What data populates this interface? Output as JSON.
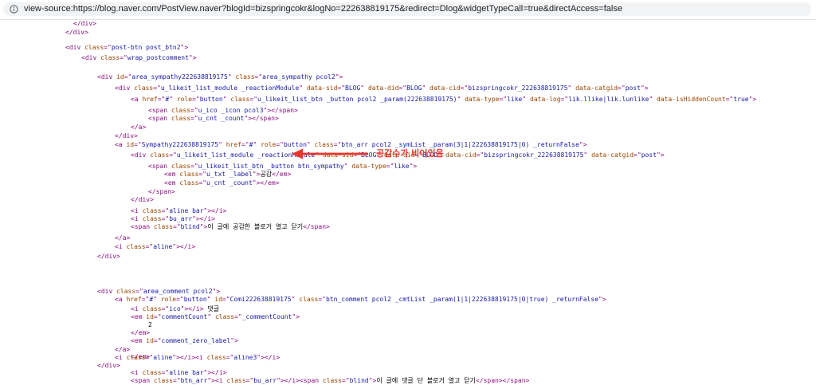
{
  "address_bar": {
    "url": "view-source:https://blog.naver.com/PostView.naver?blogId=bizspringcokr&logNo=222638819175&redirect=Dlog&widgetTypeCall=true&directAccess=false",
    "icon": "info-icon"
  },
  "annotation": {
    "text": "공감수가 비어있음",
    "color": "#e8382c",
    "icon": "arrow-left-icon"
  },
  "source_lines": [
    [
      {
        "t": "tag",
        "v": "</div>"
      }
    ],
    [
      {
        "t": "tag",
        "v": "</div>"
      }
    ],
    [],
    [
      {
        "t": "tag",
        "v": "<div "
      },
      {
        "t": "attr",
        "v": "class"
      },
      {
        "t": "tag",
        "v": "=\""
      },
      {
        "t": "val",
        "v": "post-btn post_btn2"
      },
      {
        "t": "tag",
        "v": "\">"
      }
    ],
    [
      {
        "t": "tag",
        "v": "<div "
      },
      {
        "t": "attr",
        "v": "class"
      },
      {
        "t": "tag",
        "v": "=\""
      },
      {
        "t": "val",
        "v": "wrap_postcomment"
      },
      {
        "t": "tag",
        "v": "\">"
      }
    ],
    [],
    [
      {
        "t": "tag",
        "v": "<div "
      },
      {
        "t": "attr",
        "v": "id"
      },
      {
        "t": "tag",
        "v": "=\""
      },
      {
        "t": "val",
        "v": "area_sympathy222638819175"
      },
      {
        "t": "tag",
        "v": "\" "
      },
      {
        "t": "attr",
        "v": "class"
      },
      {
        "t": "tag",
        "v": "=\""
      },
      {
        "t": "val",
        "v": "area_sympathy pcol2"
      },
      {
        "t": "tag",
        "v": "\">"
      }
    ],
    [
      {
        "t": "tag",
        "v": "<div "
      },
      {
        "t": "attr",
        "v": "class"
      },
      {
        "t": "tag",
        "v": "=\""
      },
      {
        "t": "val",
        "v": "u_likeit_list_module _reactionModule"
      },
      {
        "t": "tag",
        "v": "\" "
      },
      {
        "t": "attr",
        "v": "data-sid"
      },
      {
        "t": "tag",
        "v": "=\""
      },
      {
        "t": "val",
        "v": "BLOG"
      },
      {
        "t": "tag",
        "v": "\" "
      },
      {
        "t": "attr",
        "v": "data-did"
      },
      {
        "t": "tag",
        "v": "=\""
      },
      {
        "t": "val",
        "v": "BLOG"
      },
      {
        "t": "tag",
        "v": "\" "
      },
      {
        "t": "attr",
        "v": "data-cid"
      },
      {
        "t": "tag",
        "v": "=\""
      },
      {
        "t": "val",
        "v": "bizspringcokr_222638819175"
      },
      {
        "t": "tag",
        "v": "\" "
      },
      {
        "t": "attr",
        "v": "data-catgid"
      },
      {
        "t": "tag",
        "v": "=\""
      },
      {
        "t": "val",
        "v": "post"
      },
      {
        "t": "tag",
        "v": "\">"
      }
    ],
    [
      {
        "t": "tag",
        "v": "<a "
      },
      {
        "t": "attr",
        "v": "href"
      },
      {
        "t": "tag",
        "v": "=\""
      },
      {
        "t": "val",
        "v": "#"
      },
      {
        "t": "tag",
        "v": "\" "
      },
      {
        "t": "attr",
        "v": "role"
      },
      {
        "t": "tag",
        "v": "=\""
      },
      {
        "t": "val",
        "v": "button"
      },
      {
        "t": "tag",
        "v": "\" "
      },
      {
        "t": "attr",
        "v": "class"
      },
      {
        "t": "tag",
        "v": "=\""
      },
      {
        "t": "val",
        "v": "u_likeit_list_btn _button pcol2 _param(222638819175)"
      },
      {
        "t": "tag",
        "v": "\" "
      },
      {
        "t": "attr",
        "v": "data-type"
      },
      {
        "t": "tag",
        "v": "=\""
      },
      {
        "t": "val",
        "v": "like"
      },
      {
        "t": "tag",
        "v": "\" "
      },
      {
        "t": "attr",
        "v": "data-log"
      },
      {
        "t": "tag",
        "v": "=\""
      },
      {
        "t": "val",
        "v": "lik.llike|lik.lunlike"
      },
      {
        "t": "tag",
        "v": "\" "
      },
      {
        "t": "attr",
        "v": "data-isHiddenCount"
      },
      {
        "t": "tag",
        "v": "=\""
      },
      {
        "t": "val",
        "v": "true"
      },
      {
        "t": "tag",
        "v": "\">"
      }
    ],
    [
      {
        "t": "tag",
        "v": "<span "
      },
      {
        "t": "attr",
        "v": "class"
      },
      {
        "t": "tag",
        "v": "=\""
      },
      {
        "t": "val",
        "v": "u_ico _icon pcol3"
      },
      {
        "t": "tag",
        "v": "\"></span>"
      }
    ],
    [
      {
        "t": "tag",
        "v": "<span "
      },
      {
        "t": "attr",
        "v": "class"
      },
      {
        "t": "tag",
        "v": "=\""
      },
      {
        "t": "val",
        "v": "u_cnt _count"
      },
      {
        "t": "tag",
        "v": "\"></span>"
      }
    ],
    [
      {
        "t": "tag",
        "v": "</a>"
      }
    ],
    [
      {
        "t": "tag",
        "v": "</div>"
      }
    ],
    [
      {
        "t": "tag",
        "v": "<a "
      },
      {
        "t": "attr",
        "v": "id"
      },
      {
        "t": "tag",
        "v": "=\""
      },
      {
        "t": "val",
        "v": "Sympathy222638819175"
      },
      {
        "t": "tag",
        "v": "\" "
      },
      {
        "t": "attr",
        "v": "href"
      },
      {
        "t": "tag",
        "v": "=\""
      },
      {
        "t": "val",
        "v": "#"
      },
      {
        "t": "tag",
        "v": "\" "
      },
      {
        "t": "attr",
        "v": "role"
      },
      {
        "t": "tag",
        "v": "=\""
      },
      {
        "t": "val",
        "v": "button"
      },
      {
        "t": "tag",
        "v": "\" "
      },
      {
        "t": "attr",
        "v": "class"
      },
      {
        "t": "tag",
        "v": "=\""
      },
      {
        "t": "val",
        "v": "btn_arr pcol2 _symList _param(3|1|222638819175|0) _returnFalse"
      },
      {
        "t": "tag",
        "v": "\">"
      }
    ],
    [
      {
        "t": "tag",
        "v": "<div "
      },
      {
        "t": "attr",
        "v": "class"
      },
      {
        "t": "tag",
        "v": "=\""
      },
      {
        "t": "val",
        "v": "u_likeit_list_module _reactionModule"
      },
      {
        "t": "tag",
        "v": "\" "
      },
      {
        "t": "attr",
        "v": "data-sid"
      },
      {
        "t": "tag",
        "v": "=\""
      },
      {
        "t": "val",
        "v": "BLOG"
      },
      {
        "t": "tag",
        "v": "\" "
      },
      {
        "t": "attr",
        "v": "data-did"
      },
      {
        "t": "tag",
        "v": "=\""
      },
      {
        "t": "val",
        "v": "BLOG"
      },
      {
        "t": "tag",
        "v": "\" "
      },
      {
        "t": "attr",
        "v": "data-cid"
      },
      {
        "t": "tag",
        "v": "=\""
      },
      {
        "t": "val",
        "v": "bizspringcokr_222638819175"
      },
      {
        "t": "tag",
        "v": "\" "
      },
      {
        "t": "attr",
        "v": "data-catgid"
      },
      {
        "t": "tag",
        "v": "=\""
      },
      {
        "t": "val",
        "v": "post"
      },
      {
        "t": "tag",
        "v": "\">"
      }
    ],
    [
      {
        "t": "tag",
        "v": "<span "
      },
      {
        "t": "attr",
        "v": "class"
      },
      {
        "t": "tag",
        "v": "=\""
      },
      {
        "t": "val",
        "v": "u_likeit_list_btn _button btn_sympathy"
      },
      {
        "t": "tag",
        "v": "\" "
      },
      {
        "t": "attr",
        "v": "data-type"
      },
      {
        "t": "tag",
        "v": "=\""
      },
      {
        "t": "val",
        "v": "like"
      },
      {
        "t": "tag",
        "v": "\">"
      }
    ],
    [
      {
        "t": "tag",
        "v": "<em "
      },
      {
        "t": "attr",
        "v": "class"
      },
      {
        "t": "tag",
        "v": "=\""
      },
      {
        "t": "val",
        "v": "u_txt _label"
      },
      {
        "t": "tag",
        "v": "\">"
      },
      {
        "t": "text",
        "v": "공감"
      },
      {
        "t": "tag",
        "v": "</em>"
      }
    ],
    [
      {
        "t": "tag",
        "v": "<em "
      },
      {
        "t": "attr",
        "v": "class"
      },
      {
        "t": "tag",
        "v": "=\""
      },
      {
        "t": "val",
        "v": "u_cnt _count"
      },
      {
        "t": "tag",
        "v": "\"></em>"
      }
    ],
    [
      {
        "t": "tag",
        "v": "</span>"
      }
    ],
    [
      {
        "t": "tag",
        "v": "</div>"
      }
    ],
    [
      {
        "t": "tag",
        "v": "<i "
      },
      {
        "t": "attr",
        "v": "class"
      },
      {
        "t": "tag",
        "v": "=\""
      },
      {
        "t": "val",
        "v": "aline bar"
      },
      {
        "t": "tag",
        "v": "\"></i>"
      }
    ],
    [
      {
        "t": "tag",
        "v": "<i "
      },
      {
        "t": "attr",
        "v": "class"
      },
      {
        "t": "tag",
        "v": "=\""
      },
      {
        "t": "val",
        "v": "bu_arr"
      },
      {
        "t": "tag",
        "v": "\"></i>"
      }
    ],
    [
      {
        "t": "tag",
        "v": "<span "
      },
      {
        "t": "attr",
        "v": "class"
      },
      {
        "t": "tag",
        "v": "=\""
      },
      {
        "t": "val",
        "v": "blind"
      },
      {
        "t": "tag",
        "v": "\">"
      },
      {
        "t": "text",
        "v": "이 글에 공감한 블로거 열고 닫기"
      },
      {
        "t": "tag",
        "v": "</span>"
      }
    ],
    [
      {
        "t": "tag",
        "v": "</a>"
      }
    ],
    [
      {
        "t": "tag",
        "v": "<i "
      },
      {
        "t": "attr",
        "v": "class"
      },
      {
        "t": "tag",
        "v": "=\""
      },
      {
        "t": "val",
        "v": "aline"
      },
      {
        "t": "tag",
        "v": "\"></i>"
      }
    ],
    [
      {
        "t": "tag",
        "v": "</div>"
      }
    ],
    [],
    [],
    [],
    [
      {
        "t": "tag",
        "v": "<div "
      },
      {
        "t": "attr",
        "v": "class"
      },
      {
        "t": "tag",
        "v": "=\""
      },
      {
        "t": "val",
        "v": "area_comment pcol2"
      },
      {
        "t": "tag",
        "v": "\">"
      }
    ],
    [
      {
        "t": "tag",
        "v": "<a "
      },
      {
        "t": "attr",
        "v": "href"
      },
      {
        "t": "tag",
        "v": "=\""
      },
      {
        "t": "val",
        "v": "#"
      },
      {
        "t": "tag",
        "v": "\" "
      },
      {
        "t": "attr",
        "v": "role"
      },
      {
        "t": "tag",
        "v": "=\""
      },
      {
        "t": "val",
        "v": "button"
      },
      {
        "t": "tag",
        "v": "\" "
      },
      {
        "t": "attr",
        "v": "id"
      },
      {
        "t": "tag",
        "v": "=\""
      },
      {
        "t": "val",
        "v": "Comi222638819175"
      },
      {
        "t": "tag",
        "v": "\" "
      },
      {
        "t": "attr",
        "v": "class"
      },
      {
        "t": "tag",
        "v": "=\""
      },
      {
        "t": "val",
        "v": "btn_comment pcol2 _cmtList _param(1|1|222638819175|0|true) _returnFalse"
      },
      {
        "t": "tag",
        "v": "\">"
      }
    ],
    [
      {
        "t": "tag",
        "v": "<i "
      },
      {
        "t": "attr",
        "v": "class"
      },
      {
        "t": "tag",
        "v": "=\""
      },
      {
        "t": "val",
        "v": "ico"
      },
      {
        "t": "tag",
        "v": "\"></i>"
      },
      {
        "t": "text",
        "v": " 댓글"
      }
    ],
    [
      {
        "t": "tag",
        "v": "<em "
      },
      {
        "t": "attr",
        "v": "id"
      },
      {
        "t": "tag",
        "v": "=\""
      },
      {
        "t": "val",
        "v": "commentCount"
      },
      {
        "t": "tag",
        "v": "\" "
      },
      {
        "t": "attr",
        "v": "class"
      },
      {
        "t": "tag",
        "v": "=\""
      },
      {
        "t": "val",
        "v": "_commentCount"
      },
      {
        "t": "tag",
        "v": "\">"
      }
    ],
    [
      {
        "t": "text",
        "v": "2"
      }
    ],
    [
      {
        "t": "tag",
        "v": "</em>"
      }
    ],
    [
      {
        "t": "tag",
        "v": "<em "
      },
      {
        "t": "attr",
        "v": "id"
      },
      {
        "t": "tag",
        "v": "=\""
      },
      {
        "t": "val",
        "v": "comment_zero_label"
      },
      {
        "t": "tag",
        "v": "\">"
      }
    ],
    [],
    [
      {
        "t": "tag",
        "v": "</em>"
      }
    ],
    [],
    [
      {
        "t": "tag",
        "v": "<i "
      },
      {
        "t": "attr",
        "v": "class"
      },
      {
        "t": "tag",
        "v": "=\""
      },
      {
        "t": "val",
        "v": "aline bar"
      },
      {
        "t": "tag",
        "v": "\"></i>"
      }
    ],
    [
      {
        "t": "tag",
        "v": "<span "
      },
      {
        "t": "attr",
        "v": "class"
      },
      {
        "t": "tag",
        "v": "=\""
      },
      {
        "t": "val",
        "v": "btn_arr"
      },
      {
        "t": "tag",
        "v": "\"><i "
      },
      {
        "t": "attr",
        "v": "class"
      },
      {
        "t": "tag",
        "v": "=\""
      },
      {
        "t": "val",
        "v": "bu_arr"
      },
      {
        "t": "tag",
        "v": "\"></i><span "
      },
      {
        "t": "attr",
        "v": "class"
      },
      {
        "t": "tag",
        "v": "=\""
      },
      {
        "t": "val",
        "v": "blind"
      },
      {
        "t": "tag",
        "v": "\">"
      },
      {
        "t": "text",
        "v": "이 글에 댓글 단 블로거 열고 닫기"
      },
      {
        "t": "tag",
        "v": "</span></span>"
      }
    ],
    [
      {
        "t": "tag",
        "v": "</a>"
      }
    ],
    [
      {
        "t": "tag",
        "v": "<i "
      },
      {
        "t": "attr",
        "v": "class"
      },
      {
        "t": "tag",
        "v": "=\""
      },
      {
        "t": "val",
        "v": "aline"
      },
      {
        "t": "tag",
        "v": "\"></i><i "
      },
      {
        "t": "attr",
        "v": "class"
      },
      {
        "t": "tag",
        "v": "=\""
      },
      {
        "t": "val",
        "v": "aline3"
      },
      {
        "t": "tag",
        "v": "\"></i>"
      }
    ],
    [
      {
        "t": "tag",
        "v": "</div>"
      }
    ]
  ]
}
